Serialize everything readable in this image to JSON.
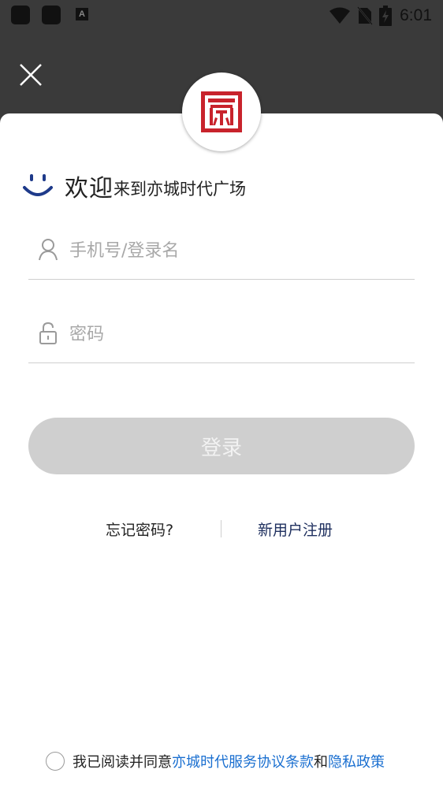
{
  "status_bar": {
    "time": "6:01",
    "left_icons": [
      "app-icon",
      "app-icon",
      "a-notification-icon"
    ],
    "right_icons": [
      "wifi-icon",
      "no-sim-icon",
      "battery-charging-icon"
    ]
  },
  "header": {
    "close_icon": "close-icon"
  },
  "welcome": {
    "big": "欢迎",
    "small": "来到亦城时代广场"
  },
  "login_form": {
    "phone_placeholder": "手机号/登录名",
    "password_placeholder": "密码",
    "login_label": "登录"
  },
  "links": {
    "forgot": "忘记密码?",
    "register": "新用户注册"
  },
  "agreement": {
    "prefix": "我已阅读并同意",
    "terms": "亦城时代服务协议条款",
    "and": "和",
    "privacy": "隐私政策"
  },
  "colors": {
    "top_bg": "#3a3a3a",
    "logo_red": "#c8232c",
    "smile_blue": "#1e3a8a",
    "link_blue": "#1a6fd0",
    "register_navy": "#1e2f5e",
    "button_disabled": "#cfcfcf"
  }
}
